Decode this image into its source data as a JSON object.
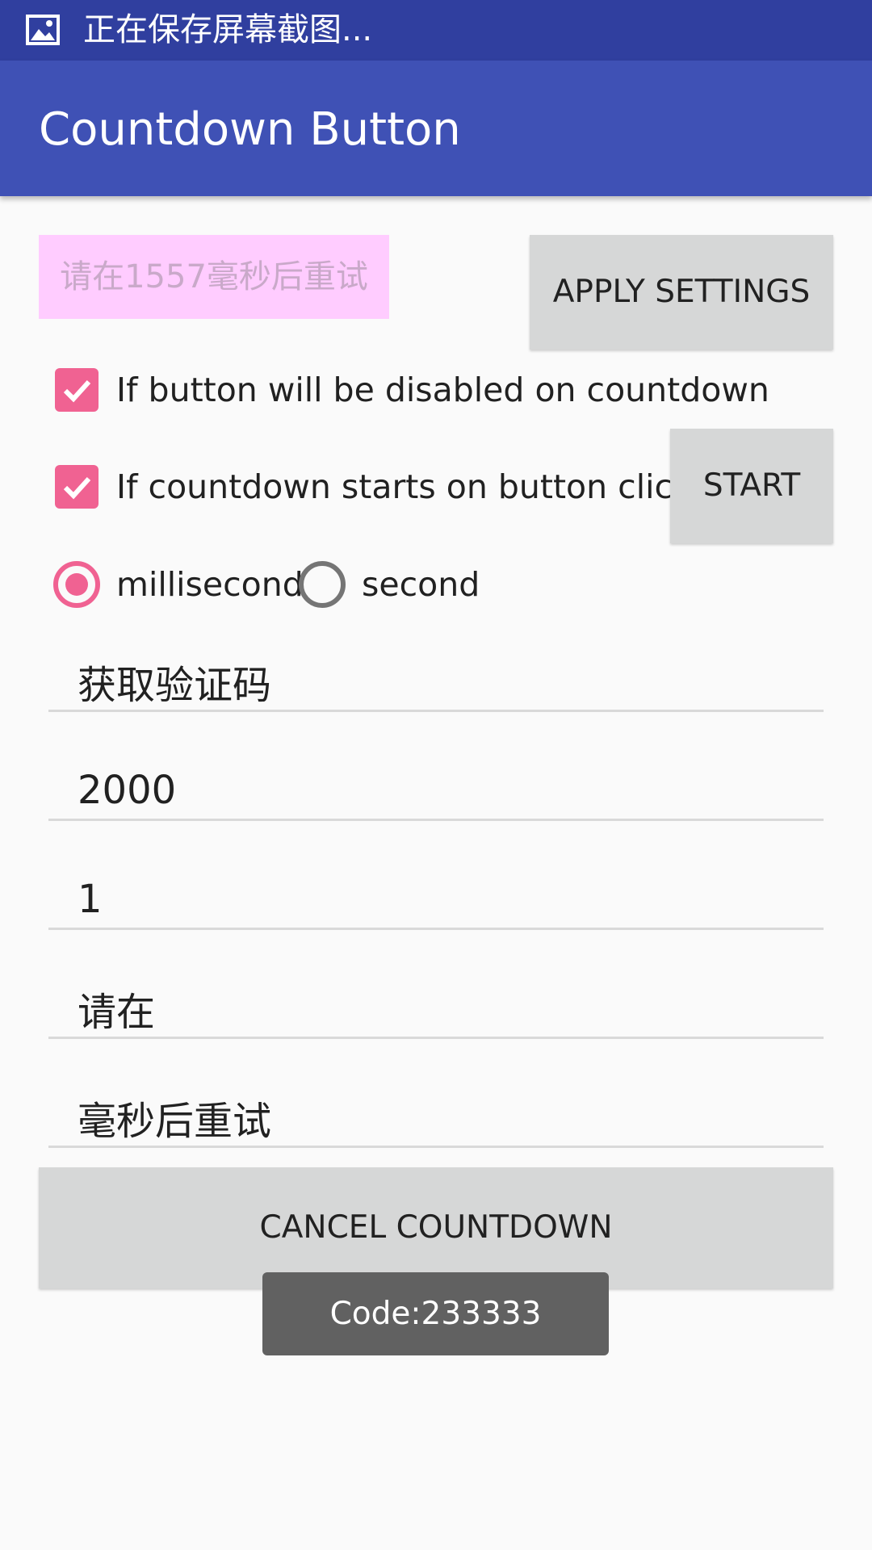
{
  "status_bar": {
    "icon": "image-icon",
    "text": "正在保存屏幕截图..."
  },
  "app_bar": {
    "title": "Countdown Button"
  },
  "countdown_button": {
    "label": "请在1557毫秒后重试",
    "color": "#ffccff"
  },
  "apply_settings_button": {
    "label": "APPLY SETTINGS"
  },
  "options": {
    "disable_on_countdown": {
      "label": "If button will be disabled on countdown",
      "checked": true
    },
    "start_on_click": {
      "label": "If countdown starts on button clicked",
      "checked": true
    }
  },
  "start_button": {
    "label": "START"
  },
  "time_unit": {
    "options": [
      {
        "label": "millisecond",
        "selected": true
      },
      {
        "label": "second",
        "selected": false
      }
    ]
  },
  "fields": {
    "button_text": "获取验证码",
    "duration": "2000",
    "interval": "1",
    "prefix": "请在",
    "suffix": "毫秒后重试"
  },
  "cancel_button": {
    "label": "CANCEL COUNTDOWN"
  },
  "toast": {
    "text": "Code:233333"
  },
  "colors": {
    "primary": "#3f51b5",
    "primary_dark": "#303f9f",
    "accent": "#f06292",
    "button_gray": "#d6d7d7"
  }
}
